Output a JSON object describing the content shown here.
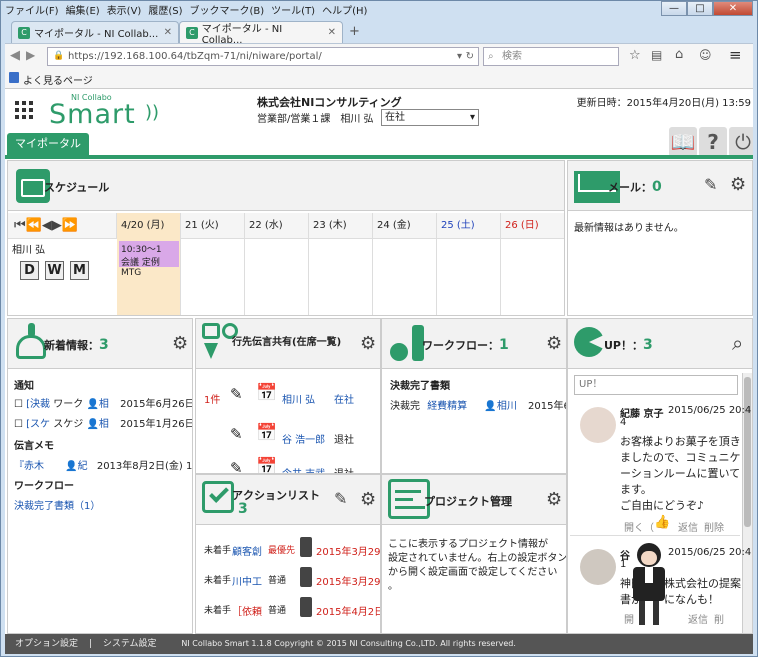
{
  "browser": {
    "menu": [
      "ファイル(F)",
      "編集(E)",
      "表示(V)",
      "履歴(S)",
      "ブックマーク(B)",
      "ツール(T)",
      "ヘルプ(H)"
    ],
    "tabs": [
      {
        "label": "マイポータル - NI Collab..."
      },
      {
        "label": "マイポータル - NI Collab..."
      }
    ],
    "url": "https://192.168.100.64/tbZqm-71/ni/niware/portal/",
    "search_placeholder": "検索",
    "bookmark": "よく見るページ"
  },
  "app": {
    "logo_small": "NI Collabo",
    "logo_big": "Smart",
    "company": "株式会社NIコンサルティング",
    "dept": "営業部/営業１課　相川 弘",
    "status": "在社",
    "updated": "更新日時：2015年4月20日(月) 13:59",
    "portal_tab": "マイポータル"
  },
  "schedule": {
    "title": "スケジュール",
    "days": [
      {
        "label": "4/20 (月)",
        "color": "#222"
      },
      {
        "label": "21 (火)",
        "color": "#222"
      },
      {
        "label": "22 (水)",
        "color": "#222"
      },
      {
        "label": "23 (木)",
        "color": "#222"
      },
      {
        "label": "24 (金)",
        "color": "#222"
      },
      {
        "label": "25 (土)",
        "color": "#2244bb"
      },
      {
        "label": "26 (日)",
        "color": "#d0201a"
      }
    ],
    "user": "相川 弘",
    "views": [
      "D",
      "W",
      "M"
    ],
    "event_time": "10:30～1",
    "event_title": "会議 定例MTG"
  },
  "mail": {
    "title": "メール：",
    "count": "0",
    "empty": "最新情報はありません。"
  },
  "news": {
    "title": "新着情報：",
    "count": "3",
    "sec1": "通知",
    "items1": [
      {
        "tag": "[決裁",
        "type": "ワーク",
        "who": "相",
        "date": "2015年6月26日("
      },
      {
        "tag": "[スケ",
        "type": "スケジ",
        "who": "相",
        "date": "2015年1月26日("
      }
    ],
    "sec2": "伝言メモ",
    "memo": {
      "tag": "『赤木",
      "who": "紀",
      "date": "2013年8月2日(金) 1"
    },
    "sec3": "ワークフロー",
    "wf": "決裁完了書類（1）"
  },
  "dengon": {
    "title": "行先伝言共有(在席一覧)",
    "count_label": "1件",
    "rows": [
      {
        "name": "相川 弘",
        "status": "在社"
      },
      {
        "name": "谷 浩一郎",
        "status": "退社"
      },
      {
        "name": "今井 吉武",
        "status": "退社"
      }
    ]
  },
  "workflow": {
    "title": "ワークフロー：",
    "count": "1",
    "section": "決裁完了書類",
    "row_status": "決裁完",
    "row_name": "経費精算",
    "row_who": "相川",
    "row_date": "2015年6"
  },
  "up": {
    "title": "UP！：",
    "count": "3",
    "input_placeholder": "UP！",
    "posts": [
      {
        "name": "紀藤 京子",
        "date": "2015/06/25 20:4",
        "date2": "4",
        "text": [
          "お客様よりお菓子を頂き",
          "ましたので、コミュニケ",
          "ーションルームに置いて",
          "ます。",
          "ご自由にどうぞ♪"
        ],
        "actions": [
          "開く（",
          "返信",
          "削除"
        ]
      },
      {
        "name": "谷",
        "date": "2015/06/25 20:4",
        "date2": "1",
        "text": [
          "神田",
          "株式会社の提案",
          "書が",
          "になんも！"
        ],
        "actions": [
          "開",
          "返信",
          "削"
        ]
      }
    ]
  },
  "actions": {
    "title": "アクションリスト",
    "count": "3",
    "rows": [
      {
        "status": "未着手",
        "name": "顧客創",
        "prio": "最優先",
        "prio_red": true,
        "date": "2015年3月29日"
      },
      {
        "status": "未着手",
        "name": "川中工",
        "prio": "普通",
        "prio_red": false,
        "date": "2015年3月29日"
      },
      {
        "status": "未着手",
        "name": "［依頼",
        "prio": "普通",
        "prio_red": false,
        "date": "2015年4月2日("
      }
    ]
  },
  "project": {
    "title": "プロジェクト管理",
    "text": [
      "ここに表示するプロジェクト情報が",
      "設定されていません。右上の設定ボタン",
      "から開く設定画面で設定してください",
      "。"
    ]
  },
  "footer": {
    "opt": "オプション設定",
    "sys": "システム設定",
    "copy": "NI Collabo Smart 1.1.8 Copyright © 2015 NI Consulting Co.,LTD. All rights reserved."
  }
}
